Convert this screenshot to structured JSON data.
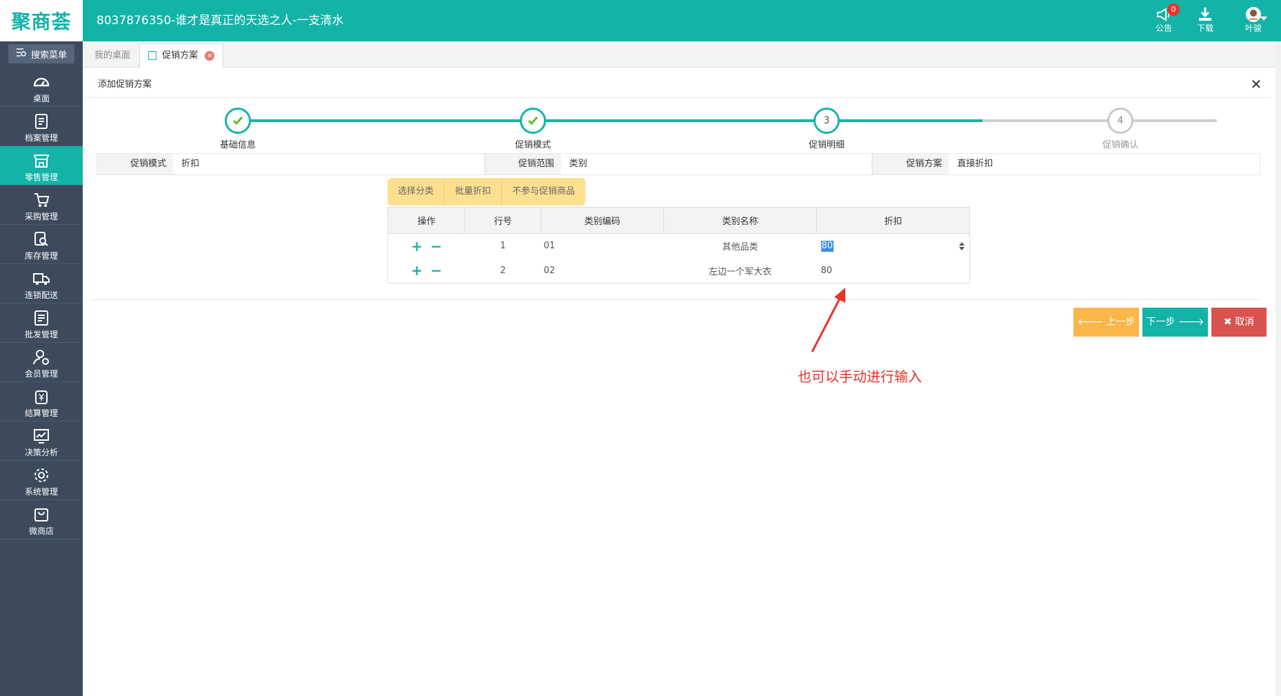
{
  "app": {
    "logo": "聚商荟",
    "title": "8037876350-谁才是真正的天选之人-一支清水"
  },
  "topbar": {
    "notice_label": "公告",
    "notice_badge": "0",
    "download_label": "下载",
    "user_label": "叶骏"
  },
  "sidebar": {
    "search_label": "搜索菜单",
    "items": [
      {
        "label": "桌面",
        "icon": "dashboard-icon"
      },
      {
        "label": "档案管理",
        "icon": "archive-icon"
      },
      {
        "label": "零售管理",
        "icon": "store-icon",
        "active": true
      },
      {
        "label": "采购管理",
        "icon": "cart-icon"
      },
      {
        "label": "库存管理",
        "icon": "inventory-search-icon"
      },
      {
        "label": "连锁配送",
        "icon": "truck-icon"
      },
      {
        "label": "批发管理",
        "icon": "wholesale-icon"
      },
      {
        "label": "会员管理",
        "icon": "member-icon"
      },
      {
        "label": "结算管理",
        "icon": "settlement-icon"
      },
      {
        "label": "决策分析",
        "icon": "analysis-icon"
      },
      {
        "label": "系统管理",
        "icon": "gear-icon"
      },
      {
        "label": "微商店",
        "icon": "shop-bag-icon"
      }
    ]
  },
  "tabs": [
    {
      "label": "我的桌面",
      "active": false
    },
    {
      "label": "促销方案",
      "active": true
    }
  ],
  "panel": {
    "title": "添加促销方案"
  },
  "steps": [
    {
      "label": "基础信息",
      "state": "done"
    },
    {
      "label": "促销模式",
      "state": "done"
    },
    {
      "label": "促销明细",
      "state": "current",
      "number": "3"
    },
    {
      "label": "促销确认",
      "state": "pending",
      "number": "4"
    }
  ],
  "info": [
    {
      "key": "促销模式",
      "value": "折扣"
    },
    {
      "key": "促销范围",
      "value": "类别"
    },
    {
      "key": "促销方案",
      "value": "直接折扣"
    }
  ],
  "toolbar": {
    "choose_category": "选择分类",
    "batch_discount": "批量折扣",
    "exclude_goods": "不参与促销商品"
  },
  "table": {
    "headers": [
      "操作",
      "行号",
      "类别编码",
      "类别名称",
      "折扣"
    ],
    "rows": [
      {
        "row_no": "1",
        "code": "01",
        "name": "其他品类",
        "discount": "80"
      },
      {
        "row_no": "2",
        "code": "02",
        "name": "左边一个军大衣",
        "discount": "80"
      }
    ]
  },
  "actions": {
    "prev": "上一步",
    "next": "下一步",
    "cancel": "取消"
  },
  "annotation": "也可以手动进行输入",
  "colors": {
    "primary": "#14b3a8",
    "sidebar": "#3c4a5c",
    "warning": "#f9b74b",
    "danger": "#d9534f",
    "annotation": "#e8322a"
  }
}
